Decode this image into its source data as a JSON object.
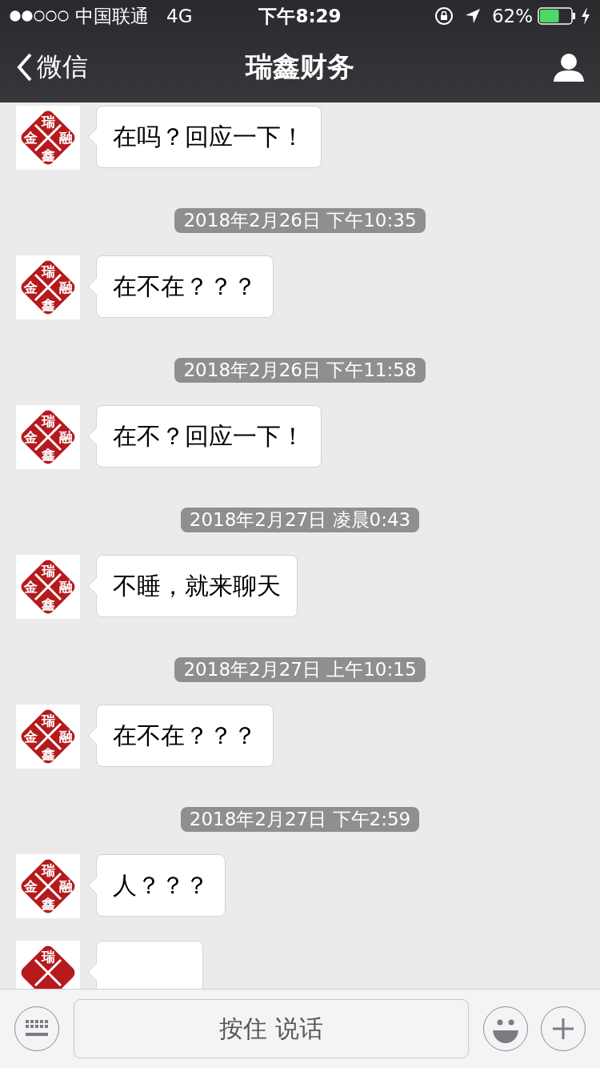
{
  "status_bar": {
    "carrier": "中国联通",
    "network": "4G",
    "time": "下午8:29",
    "battery_percent": "62%",
    "battery": {
      "level": 0.62,
      "charging": true
    }
  },
  "nav": {
    "back_label": "微信",
    "title": "瑞鑫财务"
  },
  "messages": [
    {
      "kind": "message",
      "text": "在吗？回应一下！",
      "avatar_chars": [
        "瑞",
        "融",
        "鑫",
        "金"
      ]
    },
    {
      "kind": "time",
      "text": "2018年2月26日 下午10:35"
    },
    {
      "kind": "message",
      "text": "在不在？？？",
      "avatar_chars": [
        "瑞",
        "融",
        "鑫",
        "金"
      ]
    },
    {
      "kind": "time",
      "text": "2018年2月26日 下午11:58"
    },
    {
      "kind": "message",
      "text": "在不？回应一下！",
      "avatar_chars": [
        "瑞",
        "融",
        "鑫",
        "金"
      ]
    },
    {
      "kind": "time",
      "text": "2018年2月27日 凌晨0:43"
    },
    {
      "kind": "message",
      "text": "不睡，就来聊天",
      "avatar_chars": [
        "瑞",
        "融",
        "鑫",
        "金"
      ]
    },
    {
      "kind": "time",
      "text": "2018年2月27日 上午10:15"
    },
    {
      "kind": "message",
      "text": "在不在？？？",
      "avatar_chars": [
        "瑞",
        "融",
        "鑫",
        "金"
      ]
    },
    {
      "kind": "time",
      "text": "2018年2月27日 下午2:59"
    },
    {
      "kind": "message",
      "text": "人？？？",
      "avatar_chars": [
        "瑞",
        "融",
        "鑫",
        "金"
      ]
    },
    {
      "kind": "message",
      "avatar_chars": [
        "瑞"
      ]
    }
  ],
  "input_bar": {
    "voice_button": "按住 说话"
  }
}
